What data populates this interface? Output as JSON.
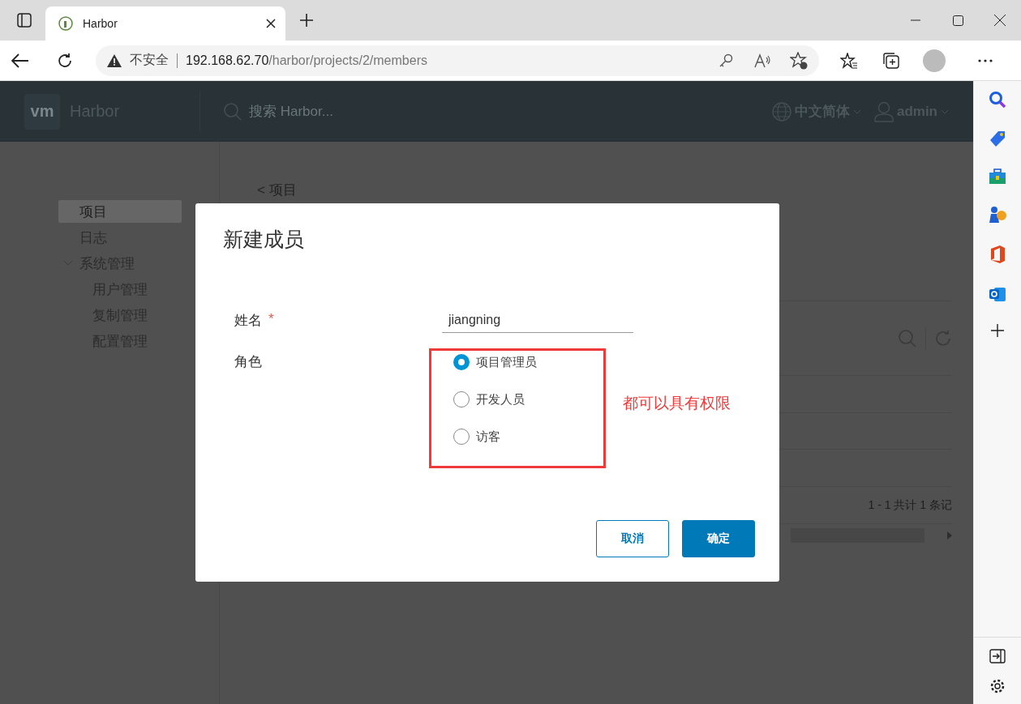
{
  "browser": {
    "tab": {
      "title": "Harbor"
    },
    "address": {
      "security": "不安全",
      "host": "192.168.62.70",
      "path": "/harbor/projects/2/members"
    }
  },
  "header": {
    "logo": "vm",
    "brand": "Harbor",
    "search": {
      "placeholder": "搜索 Harbor..."
    },
    "language": "中文简体",
    "user": "admin"
  },
  "nav": {
    "items": [
      {
        "label": "项目",
        "selected": true
      },
      {
        "label": "日志",
        "selected": false
      },
      {
        "label": "系统管理",
        "selected": false,
        "expanded": true,
        "children": [
          {
            "label": "用户管理",
            "selected": false
          },
          {
            "label": "复制管理",
            "selected": false
          },
          {
            "label": "配置管理",
            "selected": false
          }
        ]
      }
    ]
  },
  "content": {
    "back_link": "< 项目",
    "pagination": "1 - 1 共计 1 条记"
  },
  "dialog": {
    "title": "新建成员",
    "name_field": {
      "label": "姓名",
      "required": true,
      "required_mark": "*",
      "value": "jiangning"
    },
    "role_field": {
      "label": "角色",
      "options": [
        {
          "label": "项目管理员",
          "selected": true
        },
        {
          "label": "开发人员",
          "selected": false
        },
        {
          "label": "访客",
          "selected": false
        }
      ]
    },
    "buttons": [
      {
        "kind": "secondary",
        "label": "取消"
      },
      {
        "kind": "primary",
        "label": "确定"
      }
    ]
  },
  "annotation": {
    "text": "都可以具有权限"
  }
}
